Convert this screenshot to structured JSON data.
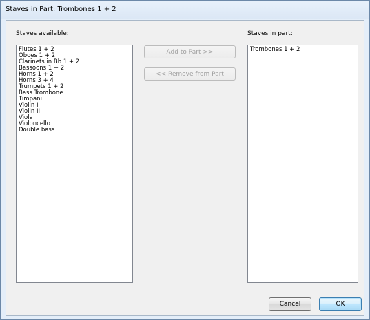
{
  "window": {
    "title": "Staves in Part: Trombones 1 + 2"
  },
  "available": {
    "label": "Staves available:",
    "items": [
      "Flutes 1 + 2",
      "Oboes 1 + 2",
      "Clarinets in Bb 1 + 2",
      "Bassoons 1 + 2",
      "Horns 1 + 2",
      "Horns 3 + 4",
      "Trumpets 1 + 2",
      "Bass Trombone",
      "Timpani",
      "Violin I",
      "Violin II",
      "Viola",
      "Violoncello",
      "Double bass"
    ]
  },
  "in_part": {
    "label": "Staves in part:",
    "items": [
      "Trombones 1 + 2"
    ]
  },
  "buttons": {
    "add": "Add to Part >>",
    "remove": "<< Remove from Part",
    "cancel": "Cancel",
    "ok": "OK"
  }
}
